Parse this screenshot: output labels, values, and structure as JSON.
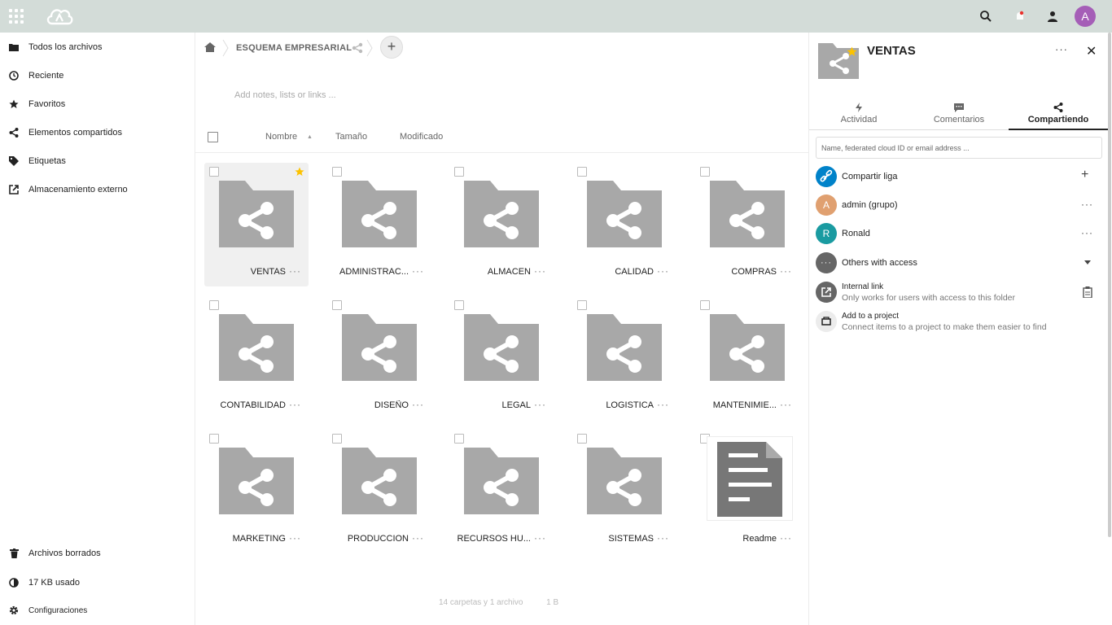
{
  "header": {
    "apps_icon": "apps-grid-icon",
    "logo_icon": "cloud-logo-icon",
    "search_icon": "search-icon",
    "notifications_icon": "notifications-icon",
    "contacts_icon": "contacts-icon",
    "avatar_letter": "A",
    "avatar_color": "#a55eb7"
  },
  "sidebar": {
    "items": [
      {
        "label": "Todos los archivos",
        "icon": "folder-icon"
      },
      {
        "label": "Reciente",
        "icon": "clock-icon"
      },
      {
        "label": "Favoritos",
        "icon": "star-icon"
      },
      {
        "label": "Elementos compartidos",
        "icon": "share-icon"
      },
      {
        "label": "Etiquetas",
        "icon": "tag-icon"
      },
      {
        "label": "Almacenamiento externo",
        "icon": "external-link-icon"
      }
    ],
    "bottom": [
      {
        "label": "Archivos borrados",
        "icon": "trash-icon"
      },
      {
        "label": "17 KB usado",
        "icon": "quota-pie-icon"
      },
      {
        "label": "Configuraciones",
        "icon": "settings-gear-icon"
      }
    ]
  },
  "breadcrumb": {
    "home_icon": "home-icon",
    "current": "ESQUEMA EMPRESARIAL",
    "add_label": "+"
  },
  "notes_placeholder": "Add notes, lists or links ...",
  "columns": {
    "name": "Nombre",
    "size": "Tamaño",
    "modified": "Modificado"
  },
  "files": [
    {
      "name": "VENTAS",
      "type": "shared-folder",
      "favorite": true,
      "selected": true
    },
    {
      "name": "ADMINISTRAC...",
      "type": "shared-folder"
    },
    {
      "name": "ALMACEN",
      "type": "shared-folder"
    },
    {
      "name": "CALIDAD",
      "type": "shared-folder"
    },
    {
      "name": "COMPRAS",
      "type": "shared-folder"
    },
    {
      "name": "CONTABILIDAD",
      "type": "shared-folder"
    },
    {
      "name": "DISEÑO",
      "type": "shared-folder"
    },
    {
      "name": "LEGAL",
      "type": "shared-folder"
    },
    {
      "name": "LOGISTICA",
      "type": "shared-folder"
    },
    {
      "name": "MANTENIMIE...",
      "type": "shared-folder"
    },
    {
      "name": "MARKETING",
      "type": "shared-folder"
    },
    {
      "name": "PRODUCCION",
      "type": "shared-folder"
    },
    {
      "name": "RECURSOS HU...",
      "type": "shared-folder"
    },
    {
      "name": "SISTEMAS",
      "type": "shared-folder"
    },
    {
      "name": "Readme",
      "type": "text-document"
    }
  ],
  "more_label": "···",
  "summary": {
    "count": "14 carpetas y 1 archivo",
    "size": "1 B"
  },
  "panel": {
    "title": "VENTAS",
    "more_label": "···",
    "close_label": "✕",
    "tabs": [
      {
        "label": "Actividad",
        "icon": "activity-bolt-icon"
      },
      {
        "label": "Comentarios",
        "icon": "comment-icon"
      },
      {
        "label": "Compartiendo",
        "icon": "share-icon",
        "active": true
      }
    ],
    "share_placeholder": "Name, federated cloud ID or email address ...",
    "rows": {
      "link": {
        "label": "Compartir liga",
        "action": "+",
        "color": "#0082c9"
      },
      "group": {
        "letter": "A",
        "label": "admin (grupo)",
        "action": "···",
        "color": "#e0a070"
      },
      "user": {
        "letter": "R",
        "label": "Ronald",
        "action": "···",
        "color": "#1a9ba1"
      },
      "others": {
        "letter": "···",
        "label": "Others with access",
        "color": "#666666"
      },
      "internal": {
        "label": "Internal link",
        "sub": "Only works for users with access to this folder"
      },
      "project": {
        "label": "Add to a project",
        "sub": "Connect items to a project to make them easier to find"
      }
    }
  },
  "colors": {
    "header_bg": "#d3dcd8",
    "folder_gray": "#a8a8a8",
    "star_yellow": "#fcc200"
  }
}
